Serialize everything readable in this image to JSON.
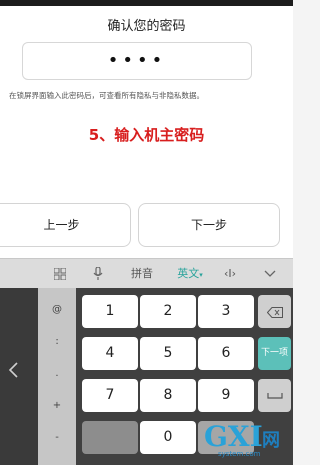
{
  "dialog": {
    "title": "确认您的密码",
    "pin_mask": "••••",
    "hint": "在锁屏界面输入此密码后，可查看所有隐私与非隐私数据。",
    "annotation": "5、输入机主密码",
    "prev_label": "上一步",
    "next_label": "下一步"
  },
  "keyboard": {
    "toolbar": {
      "mic_icon": "mic-icon",
      "pinyin_label": "拼音",
      "english_label": "英文",
      "cursor_label": "‹I›",
      "collapse_icon": "chevron-down-icon",
      "grid_icon": "grid-icon"
    },
    "symbols": [
      "@",
      ":",
      ".",
      "+",
      "-"
    ],
    "digits": [
      "1",
      "2",
      "3",
      "4",
      "5",
      "6",
      "7",
      "8",
      "9",
      "0"
    ],
    "next_item_label": "下一项",
    "accent_color": "#5cc0b9"
  },
  "watermark": {
    "logo": "GXI",
    "cn": "网",
    "url": "system.com"
  }
}
